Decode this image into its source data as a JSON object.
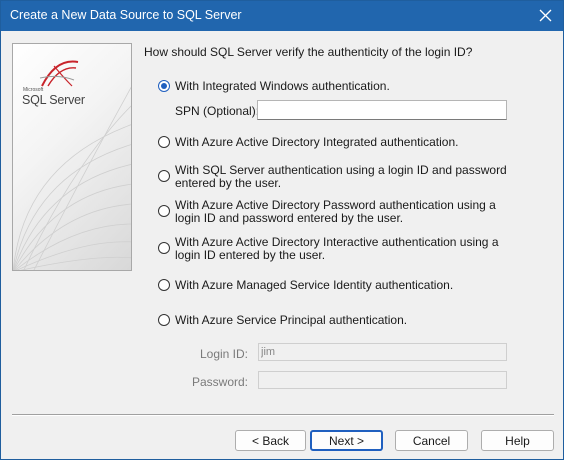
{
  "window": {
    "title": "Create a New Data Source to SQL Server"
  },
  "logo": {
    "small_text": "Microsoft",
    "product": "SQL Server"
  },
  "question": "How should SQL Server verify the authenticity of the login ID?",
  "options": [
    {
      "label": "With Integrated Windows authentication.",
      "checked": true
    },
    {
      "label": "With Azure Active Directory Integrated authentication.",
      "checked": false
    },
    {
      "label": "With SQL Server authentication using a login ID and password entered by the user.",
      "checked": false
    },
    {
      "label": "With Azure Active Directory Password authentication using a login ID and password entered by the user.",
      "checked": false
    },
    {
      "label": "With Azure Active Directory Interactive authentication using a login ID entered by the user.",
      "checked": false
    },
    {
      "label": "With Azure Managed Service Identity authentication.",
      "checked": false
    },
    {
      "label": "With Azure Service Principal authentication.",
      "checked": false
    }
  ],
  "spn": {
    "label": "SPN (Optional):",
    "value": ""
  },
  "login": {
    "label": "Login ID:",
    "value": "jim"
  },
  "password": {
    "label": "Password:",
    "value": ""
  },
  "buttons": {
    "back": "< Back",
    "next": "Next >",
    "cancel": "Cancel",
    "help": "Help"
  },
  "colors": {
    "titlebar": "#2166ae",
    "accent": "#1f5fbf",
    "logo_red": "#c8242b"
  }
}
